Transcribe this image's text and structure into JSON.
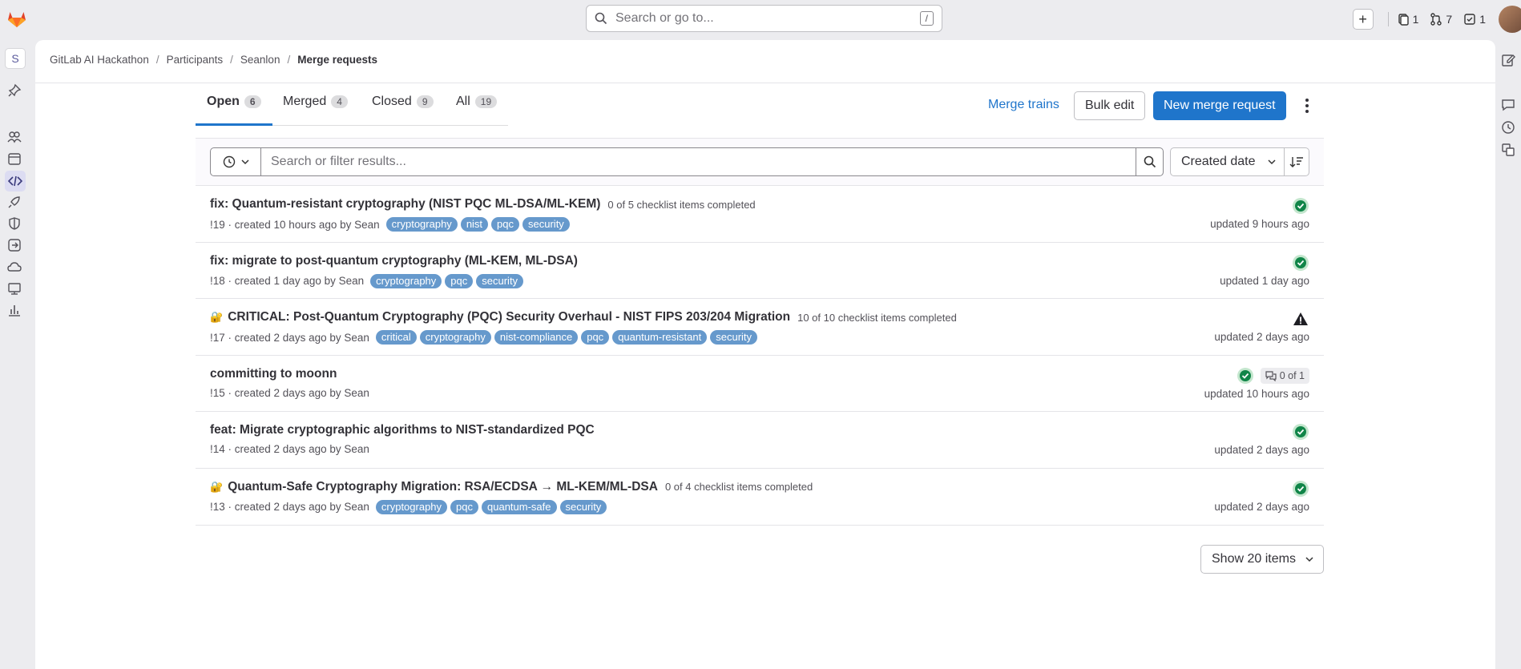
{
  "topbar": {
    "search_placeholder": "Search or go to...",
    "search_shortcut": "/",
    "issues_count": "1",
    "mr_count": "7",
    "todo_count": "1"
  },
  "sidebar": {
    "project_initial": "S"
  },
  "breadcrumb": {
    "items": [
      "GitLab AI Hackathon",
      "Participants",
      "Seanlon",
      "Merge requests"
    ]
  },
  "tabs": [
    {
      "label": "Open",
      "count": "6"
    },
    {
      "label": "Merged",
      "count": "4"
    },
    {
      "label": "Closed",
      "count": "9"
    },
    {
      "label": "All",
      "count": "19"
    }
  ],
  "actions": {
    "merge_trains": "Merge trains",
    "bulk_edit": "Bulk edit",
    "new_mr": "New merge request"
  },
  "filter": {
    "placeholder": "Search or filter results...",
    "sort_label": "Created date"
  },
  "merge_requests": [
    {
      "title": "fix: Quantum-resistant cryptography (NIST PQC ML-DSA/ML-KEM)",
      "checklist": "0 of 5 checklist items completed",
      "meta": "!19 · created 10 hours ago by Sean",
      "labels": [
        "cryptography",
        "nist",
        "pqc",
        "security"
      ],
      "updated": "updated 9 hours ago",
      "status": "passed"
    },
    {
      "title": "fix: migrate to post-quantum cryptography (ML-KEM, ML-DSA)",
      "checklist": "",
      "meta": "!18 · created 1 day ago by Sean",
      "labels": [
        "cryptography",
        "pqc",
        "security"
      ],
      "updated": "updated 1 day ago",
      "status": "passed"
    },
    {
      "title": "CRITICAL: Post-Quantum Cryptography (PQC) Security Overhaul - NIST FIPS 203/204 Migration",
      "lock": "🔐",
      "checklist": "10 of 10 checklist items completed",
      "meta": "!17 · created 2 days ago by Sean",
      "labels": [
        "critical",
        "cryptography",
        "nist-compliance",
        "pqc",
        "quantum-resistant",
        "security"
      ],
      "updated": "updated 2 days ago",
      "status": "warning"
    },
    {
      "title": "committing to moonn",
      "checklist": "",
      "meta": "!15 · created 2 days ago by Sean",
      "labels": [],
      "updated": "updated 10 hours ago",
      "status": "passed",
      "threads": "0 of 1"
    },
    {
      "title": "feat: Migrate cryptographic algorithms to NIST-standardized PQC",
      "checklist": "",
      "meta": "!14 · created 2 days ago by Sean",
      "labels": [],
      "updated": "updated 2 days ago",
      "status": "passed"
    },
    {
      "title": "Quantum-Safe Cryptography Migration: RSA/ECDSA → ML-KEM/ML-DSA",
      "lock": "🔐",
      "checklist": "0 of 4 checklist items completed",
      "meta": "!13 · created 2 days ago by Sean",
      "labels": [
        "cryptography",
        "pqc",
        "quantum-safe",
        "security"
      ],
      "updated": "updated 2 days ago",
      "status": "passed"
    }
  ],
  "pagination": {
    "show_items": "Show 20 items"
  },
  "colors": {
    "accent": "#1f75cb",
    "label": "#6699cc",
    "success": "#108548"
  }
}
